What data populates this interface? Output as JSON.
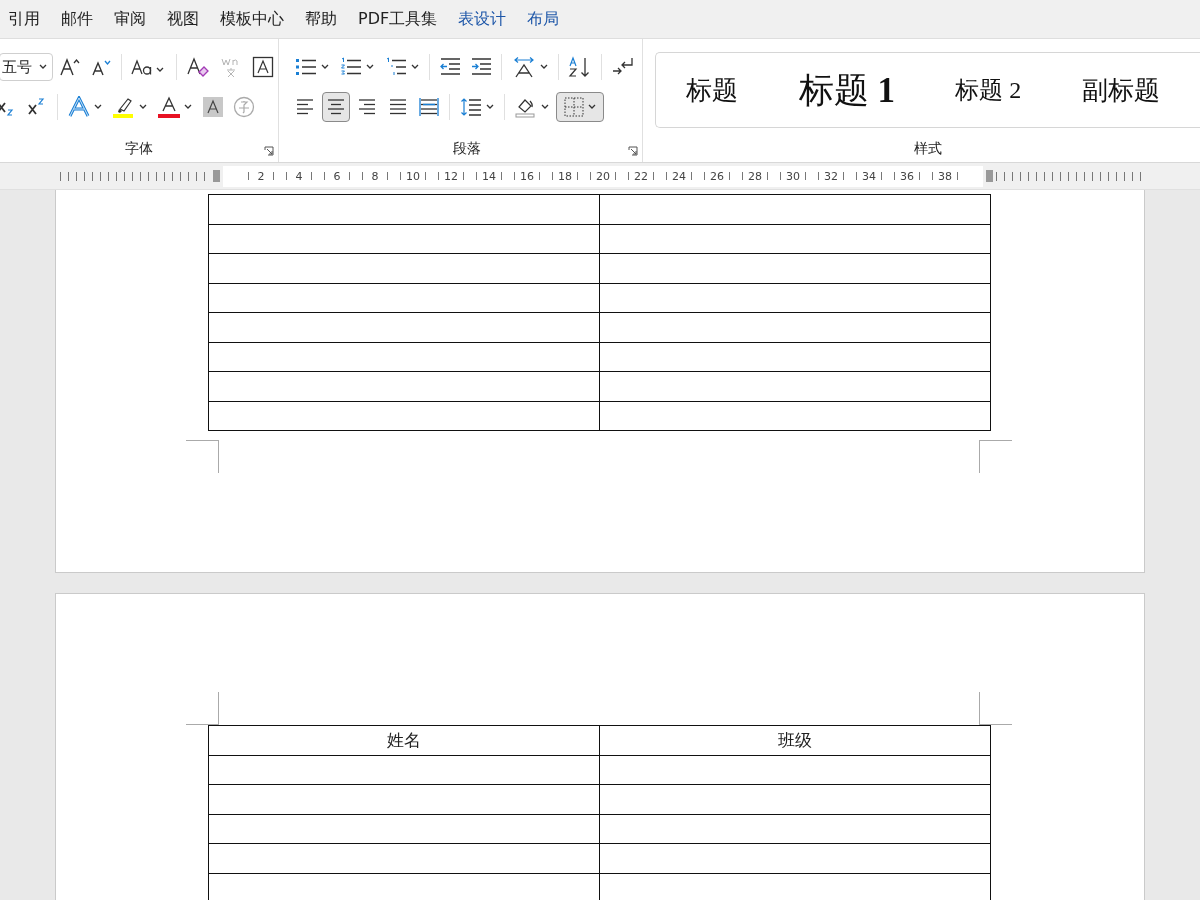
{
  "menu_tabs": [
    {
      "label": "引用",
      "contextual": false
    },
    {
      "label": "邮件",
      "contextual": false
    },
    {
      "label": "审阅",
      "contextual": false
    },
    {
      "label": "视图",
      "contextual": false
    },
    {
      "label": "模板中心",
      "contextual": false
    },
    {
      "label": "帮助",
      "contextual": false
    },
    {
      "label": "PDF工具集",
      "contextual": false
    },
    {
      "label": "表设计",
      "contextual": true
    },
    {
      "label": "布局",
      "contextual": true
    }
  ],
  "font_group": {
    "label": "字体",
    "font_size": "五号"
  },
  "paragraph_group": {
    "label": "段落",
    "alignments": [
      {
        "kind": "left",
        "selected": false
      },
      {
        "kind": "center",
        "selected": true
      },
      {
        "kind": "right",
        "selected": false
      },
      {
        "kind": "justify",
        "selected": false
      },
      {
        "kind": "distributed",
        "selected": false
      }
    ],
    "borders_button": {
      "selected": true
    }
  },
  "styles_group": {
    "label": "样式",
    "styles": [
      {
        "label": "标题",
        "kind": "title"
      },
      {
        "label": "标题 **1**",
        "kind": "heading1"
      },
      {
        "label": "标题 2",
        "kind": "heading2"
      },
      {
        "label": "副标题",
        "kind": "subtitle"
      }
    ]
  },
  "ruler": {
    "numbers": [
      "2",
      "4",
      "6",
      "8",
      "10",
      "12",
      "14",
      "16",
      "18",
      "20",
      "22",
      "24",
      "26",
      "28",
      "30",
      "32",
      "34",
      "36",
      "38"
    ]
  },
  "second_page_table": {
    "columns": [
      "姓名",
      "班级"
    ]
  }
}
